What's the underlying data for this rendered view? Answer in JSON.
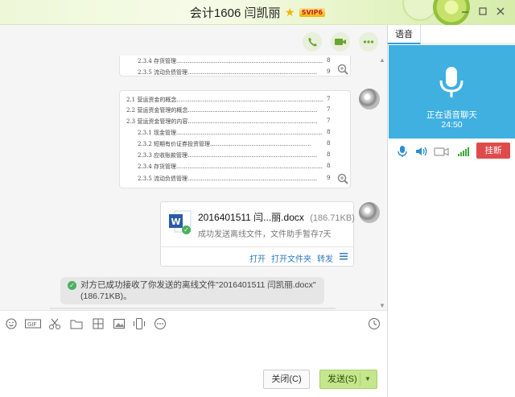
{
  "window": {
    "title": "会计1606 闫凯丽",
    "badge": "SVIP6",
    "controls": [
      "minimize",
      "maximize",
      "close"
    ]
  },
  "chat_header_actions": [
    {
      "icon": "phone-icon"
    },
    {
      "icon": "video-camera-icon"
    },
    {
      "icon": "more-options-icon"
    }
  ],
  "doc_snippet_1": {
    "lines": [
      {
        "text": "2.3.4 存货管理……………………………………………………………………",
        "page": "8"
      },
      {
        "text": "2.3.5 流动负债管理……………………………………………………………",
        "page": "9"
      }
    ]
  },
  "doc_snippet_2": {
    "lines": [
      {
        "text": "2.1 营运资金的概念……………………………………………………………………",
        "page": "7"
      },
      {
        "text": "2.2 营运资金管理的概念……………………………………………………………",
        "page": "7"
      },
      {
        "text": "2.3  营运资金管理的内容……………………………………………………………",
        "page": "7"
      },
      {
        "text": "2.3.1 现金管理……………………………………………………………………",
        "page": "8"
      },
      {
        "text": "2.3.2 短期有价证券投资管理………………………………………………",
        "page": "8"
      },
      {
        "text": "2.3.3 应收账款管理……………………………………………………………",
        "page": "8"
      },
      {
        "text": "2.3.4 存货管理……………………………………………………………………",
        "page": "8"
      },
      {
        "text": "2.3.5 流动负债管理……………………………………………………………",
        "page": "9"
      }
    ]
  },
  "file_card": {
    "name": "2016401511 闫...丽.docx",
    "size": "(186.71KB)",
    "status": "成功发送离线文件，文件助手暂存7天",
    "actions": [
      "打开",
      "打开文件夹",
      "转发"
    ]
  },
  "notice": {
    "text": "对方已成功接收了你发送的离线文件\"2016401511 闫凯丽.docx\"(186.71KB)。"
  },
  "toolbar_icons": [
    "emoji-icon",
    "gif-icon",
    "scissors-icon",
    "folder-icon",
    "image-gallery-icon",
    "picture-icon",
    "shake-icon",
    "more-icon",
    "history-icon"
  ],
  "buttons": {
    "close": "关闭(C)",
    "send": "发送(S)"
  },
  "voice_panel": {
    "tab": "语音",
    "status": "正在语音聊天",
    "timer": "24:50",
    "hangup": "挂断",
    "colors": {
      "panel_bg": "#3fb0e0",
      "hangup_bg": "#e04a4a",
      "send_bg": "#c4e68c"
    }
  }
}
